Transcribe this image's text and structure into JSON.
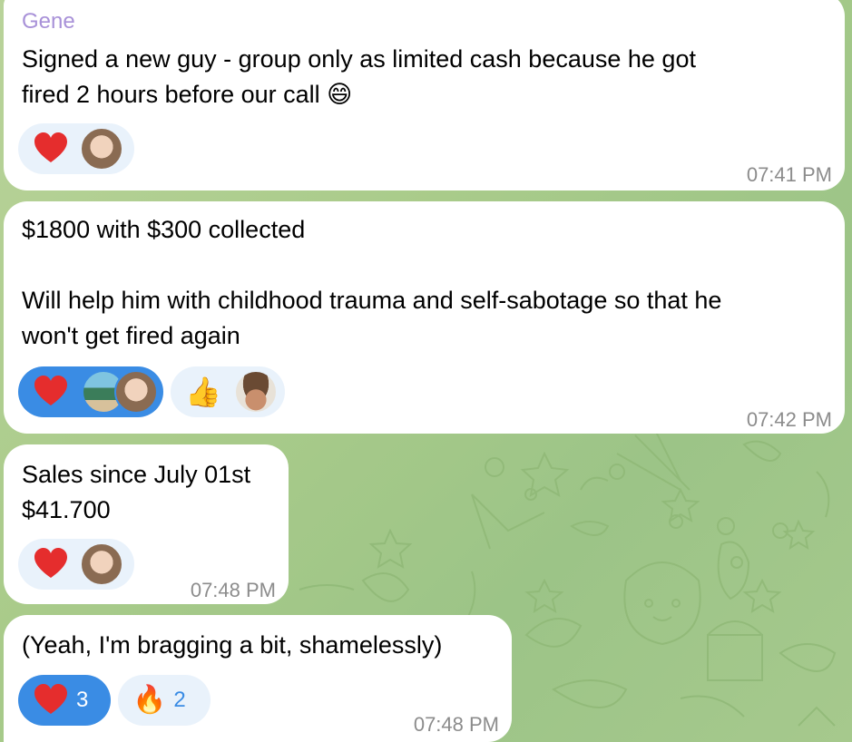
{
  "messages": [
    {
      "sender": "Gene",
      "text": "Signed a new guy - group only as limited cash because he got\nfired 2 hours before our call 😄",
      "time": "07:41 PM",
      "reactions": [
        {
          "emoji": "heart",
          "active": false,
          "avatars": [
            "user-avatar-bald"
          ]
        }
      ]
    },
    {
      "text": "$1800 with $300 collected\n\nWill help him with childhood trauma and self-sabotage so that he\nwon't get fired again",
      "time": "07:42 PM",
      "reactions": [
        {
          "emoji": "heart",
          "active": true,
          "avatars": [
            "user-avatar-beach",
            "user-avatar-bald"
          ]
        },
        {
          "emoji": "thumbs-up",
          "active": false,
          "avatars": [
            "user-avatar-hat"
          ]
        }
      ]
    },
    {
      "text": "Sales since July 01st\n$41.700",
      "time": "07:48 PM",
      "reactions": [
        {
          "emoji": "heart",
          "active": false,
          "avatars": [
            "user-avatar-bald"
          ]
        }
      ]
    },
    {
      "text": "(Yeah, I'm bragging a bit, shamelessly)",
      "time": "07:48 PM",
      "reactions": [
        {
          "emoji": "heart",
          "active": true,
          "count": "3"
        },
        {
          "emoji": "fire",
          "active": false,
          "count": "2"
        }
      ]
    }
  ],
  "colors": {
    "sender_name": "#a891d8",
    "reaction_active": "#3a8ce4",
    "reaction_inactive": "#e9f2fb",
    "heart": "#e52d2d",
    "timestamp": "#8c8c8c"
  }
}
